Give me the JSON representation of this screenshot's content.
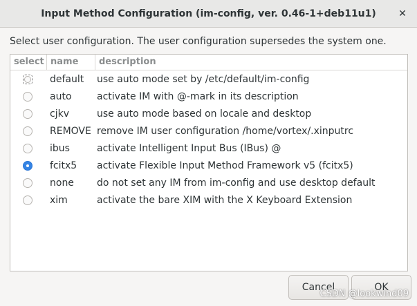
{
  "window": {
    "title": "Input Method Configuration (im-config, ver. 0.46-1+deb11u1)",
    "close_symbol": "✕"
  },
  "prompt": "Select user configuration. The user configuration supersedes the system one.",
  "table": {
    "headers": {
      "select": "select",
      "name": "name",
      "description": "description"
    },
    "rows": [
      {
        "name": "default",
        "description": "use auto mode set by /etc/default/im-config",
        "selected": false,
        "focused": true
      },
      {
        "name": "auto",
        "description": "activate IM with @-mark in its description",
        "selected": false
      },
      {
        "name": "cjkv",
        "description": "use auto mode based on locale and desktop",
        "selected": false
      },
      {
        "name": "REMOVE",
        "description": "remove IM user configuration /home/vortex/.xinputrc",
        "selected": false
      },
      {
        "name": "ibus",
        "description": "activate Intelligent Input Bus (IBus) @",
        "selected": false
      },
      {
        "name": "fcitx5",
        "description": "activate Flexible Input Method Framework v5 (fcitx5)",
        "selected": true
      },
      {
        "name": "none",
        "description": "do not set any IM from im-config and use desktop default",
        "selected": false
      },
      {
        "name": "xim",
        "description": "activate the bare XIM with the X Keyboard Extension",
        "selected": false
      }
    ]
  },
  "buttons": {
    "cancel": "Cancel",
    "ok": "OK"
  },
  "watermark": "CSDN @lookwind09",
  "colors": {
    "accent": "#3584e4",
    "background": "#f6f5f4",
    "titlebar": "#e8e8e7"
  }
}
